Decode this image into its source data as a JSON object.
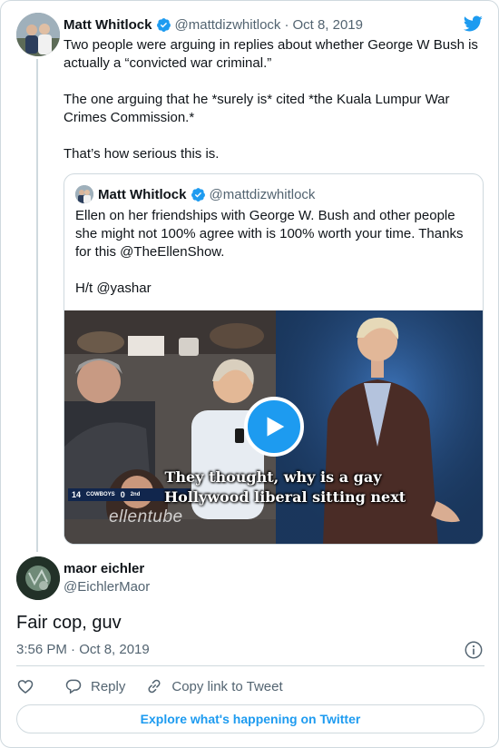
{
  "colors": {
    "brand_blue": "#1d9bf0",
    "text_primary": "#0f1419",
    "text_secondary": "#536471",
    "border": "#cfd9de"
  },
  "parent_tweet": {
    "author_name": "Matt Whitlock",
    "handle": "@mattdizwhitlock",
    "separator": "·",
    "date": "Oct 8, 2019",
    "verified_icon": "verified-badge-icon",
    "platform_icon": "twitter-bird-icon",
    "paragraphs": [
      "Two people were arguing in replies about whether George W Bush is actually a “convicted war criminal.”",
      "The one arguing that he *surely is* cited *the Kuala Lumpur War Crimes Commission.*",
      "That’s how serious this is."
    ]
  },
  "quoted_tweet": {
    "author_name": "Matt Whitlock",
    "handle": "@mattdizwhitlock",
    "paragraphs": [
      "Ellen on her friendships with George W. Bush and other people she might not 100% agree with is 100% worth your time. Thanks for this @TheEllenShow.",
      "H/t @yashar"
    ],
    "video": {
      "play_icon": "play-icon",
      "caption_lines": [
        "They thought, why is a gay",
        "Hollywood liberal sitting next"
      ],
      "scoreboard": {
        "left_score": "14",
        "team": "COWBOYS",
        "right_score": "0",
        "period": "2nd"
      },
      "watermark": "ellentube"
    }
  },
  "reply": {
    "author_name": "maor eichler",
    "handle": "@EichlerMaor",
    "text": "Fair cop, guv",
    "timestamp": "3:56 PM · Oct 8, 2019",
    "info_icon": "info-icon"
  },
  "actions": {
    "like_icon": "heart-icon",
    "reply_label": "Reply",
    "reply_icon": "reply-bubble-icon",
    "copy_link_label": "Copy link to Tweet",
    "copy_link_icon": "link-icon"
  },
  "footer": {
    "explore_label": "Explore what's happening on Twitter"
  }
}
